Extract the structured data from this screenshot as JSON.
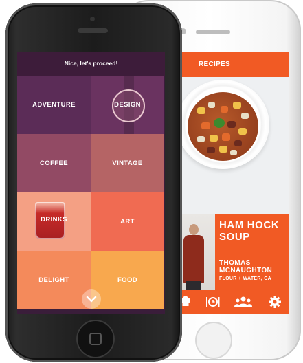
{
  "back_screen": {
    "header": {
      "title": "RECIPES"
    },
    "recipe": {
      "title": "HAM HOCK SOUP",
      "author": "THOMAS MCNAUGHTON",
      "place": "FLOUR + WATER, CA"
    },
    "tabs": [
      {
        "icon": "chef-hat-icon"
      },
      {
        "icon": "fork-clock-icon"
      },
      {
        "icon": "people-icon"
      },
      {
        "icon": "gear-icon"
      }
    ],
    "accent_color": "#f15a24"
  },
  "front_screen": {
    "header": {
      "title": "Nice, let's proceed!"
    },
    "categories": [
      {
        "label": "ADVENTURE",
        "color": "#5b2c57"
      },
      {
        "label": "DESIGN",
        "color": "#6a3360",
        "selected": true
      },
      {
        "label": "COFFEE",
        "color": "#924a64"
      },
      {
        "label": "VINTAGE",
        "color": "#b56465"
      },
      {
        "label": "DRINKS",
        "color": "#f4a084",
        "selected": true
      },
      {
        "label": "ART",
        "color": "#f06b52"
      },
      {
        "label": "DELIGHT",
        "color": "#f48a5b"
      },
      {
        "label": "FOOD",
        "color": "#f8a84e"
      }
    ],
    "proceed_icon": "chevron-down-icon"
  }
}
